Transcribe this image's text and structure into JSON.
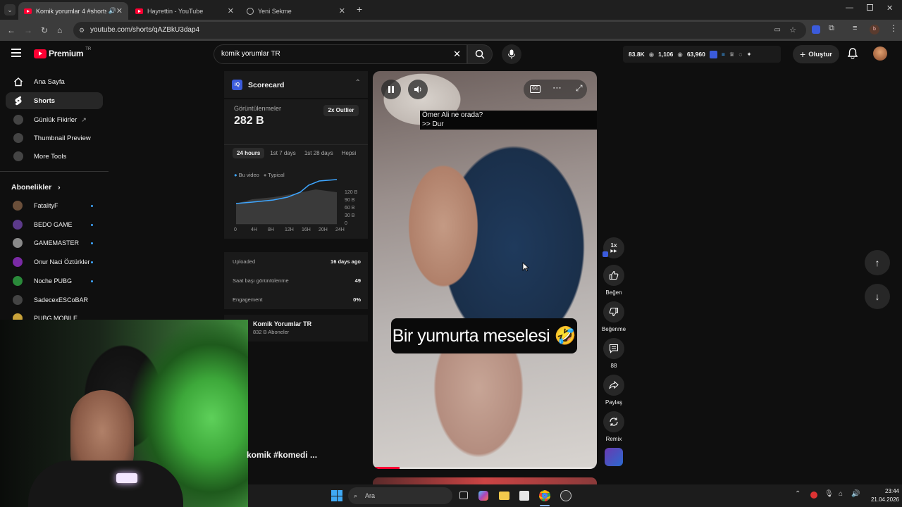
{
  "browser": {
    "tabs": [
      {
        "title": "Komik yorumlar 4 #shorts #"
      },
      {
        "title": "Hayrettin - YouTube"
      },
      {
        "title": "Yeni Sekme"
      }
    ],
    "url": "youtube.com/shorts/qAZBkU3dap4"
  },
  "header": {
    "logo": "Premium",
    "region": "TR",
    "search_value": "komik yorumlar TR",
    "stats": {
      "a": "83.8K",
      "b": "1,106",
      "c": "63,960"
    },
    "create_label": "Oluştur"
  },
  "sidebar": {
    "items": [
      {
        "label": "Ana Sayfa"
      },
      {
        "label": "Shorts"
      },
      {
        "label": "Günlük Fikirler"
      },
      {
        "label": "Thumbnail Preview"
      },
      {
        "label": "More Tools"
      }
    ],
    "subs_title": "Abonelikler",
    "subs": [
      {
        "label": "FatalityF",
        "color": "#6b4f3a"
      },
      {
        "label": "BEDO GAME",
        "color": "#5c3a8a"
      },
      {
        "label": "GAMEMASTER",
        "color": "#8a8a8a"
      },
      {
        "label": "Onur Naci Öztürkler",
        "color": "#7a2aa5"
      },
      {
        "label": "Noche PUBG",
        "color": "#2a8a3a"
      },
      {
        "label": "SadecexESCoBAR",
        "color": "#444444"
      },
      {
        "label": "PUBG MOBILE",
        "color": "#c9a23a"
      }
    ]
  },
  "scorecard": {
    "title": "Scorecard",
    "views_label": "Görüntülenmeler",
    "views_value": "282 B",
    "badge": "2x Outlier",
    "tabs": [
      "24 hours",
      "1st 7 days",
      "1st 28 days",
      "Hepsi"
    ],
    "legend_video": "Bu video",
    "legend_typical": "Typical",
    "x_ticks": [
      "0",
      "4H",
      "8H",
      "12H",
      "16H",
      "20H",
      "24H"
    ],
    "y_ticks": [
      "120 B",
      "90 B",
      "60 B",
      "30 B",
      "0"
    ],
    "rows": [
      {
        "label": "Uploaded",
        "value": "16 days ago"
      },
      {
        "label": "Saat başı görüntülenme",
        "value": "49"
      },
      {
        "label": "Engagement",
        "value": "0%"
      }
    ],
    "channel_name": "Komik Yorumlar TR",
    "channel_subs": "832 B Aboneler"
  },
  "video": {
    "caption_line1": "Ömer Ali ne orada?",
    "caption_line2": ">> Dur",
    "big_caption": "Bir yumurta meselesi 🤣",
    "title_partial": "komik #komedi ...",
    "progress": 0.12
  },
  "actions": {
    "speed": "1x",
    "like": "Beğen",
    "dislike": "Beğenme",
    "comments": "88",
    "share": "Paylaş",
    "remix": "Remix"
  },
  "taskbar": {
    "search_placeholder": "Ara",
    "time": "23:44",
    "date": "21.04.2026"
  },
  "colors": {
    "accent_red": "#ff0033",
    "blue": "#3ea6ff",
    "panel": "#1a1a1a"
  }
}
